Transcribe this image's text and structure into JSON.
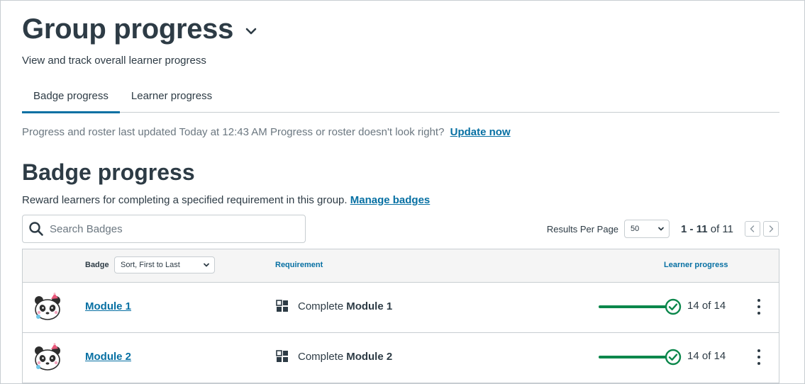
{
  "header": {
    "title": "Group progress",
    "subtitle": "View and track overall learner progress"
  },
  "tabs": [
    {
      "label": "Badge progress",
      "active": true
    },
    {
      "label": "Learner progress",
      "active": false
    }
  ],
  "status": {
    "updated_text": "Progress and roster last updated Today at 12:43 AM",
    "question_text": "Progress or roster doesn't look right?",
    "update_link": "Update now"
  },
  "section": {
    "title": "Badge progress",
    "description": "Reward learners for completing a specified requirement in this group.",
    "manage_link": "Manage badges"
  },
  "search": {
    "placeholder": "Search Badges",
    "value": ""
  },
  "pager": {
    "results_per_page_label": "Results Per Page",
    "results_per_page_value": "50",
    "range_bold": "1 - 11",
    "range_rest": "of 11"
  },
  "table": {
    "headers": {
      "badge": "Badge",
      "sort": "Sort, First to Last",
      "requirement": "Requirement",
      "progress": "Learner progress"
    },
    "rows": [
      {
        "badge": "Module 1",
        "req_prefix": "Complete",
        "req_target": "Module 1",
        "progress": "14 of 14",
        "progress_fraction": 1.0
      },
      {
        "badge": "Module 2",
        "req_prefix": "Complete",
        "req_target": "Module 2",
        "progress": "14 of 14",
        "progress_fraction": 1.0
      }
    ]
  },
  "colors": {
    "text": "#2d3b45",
    "link": "#0770a3",
    "success": "#0b874b",
    "border": "#c7cdd1",
    "muted": "#6b7780"
  },
  "icons": [
    "chevron-down-icon",
    "search-icon",
    "chevron-left-icon",
    "chevron-right-icon",
    "panda-badge-icon",
    "module-icon",
    "check-circle-icon",
    "kebab-menu-icon"
  ]
}
